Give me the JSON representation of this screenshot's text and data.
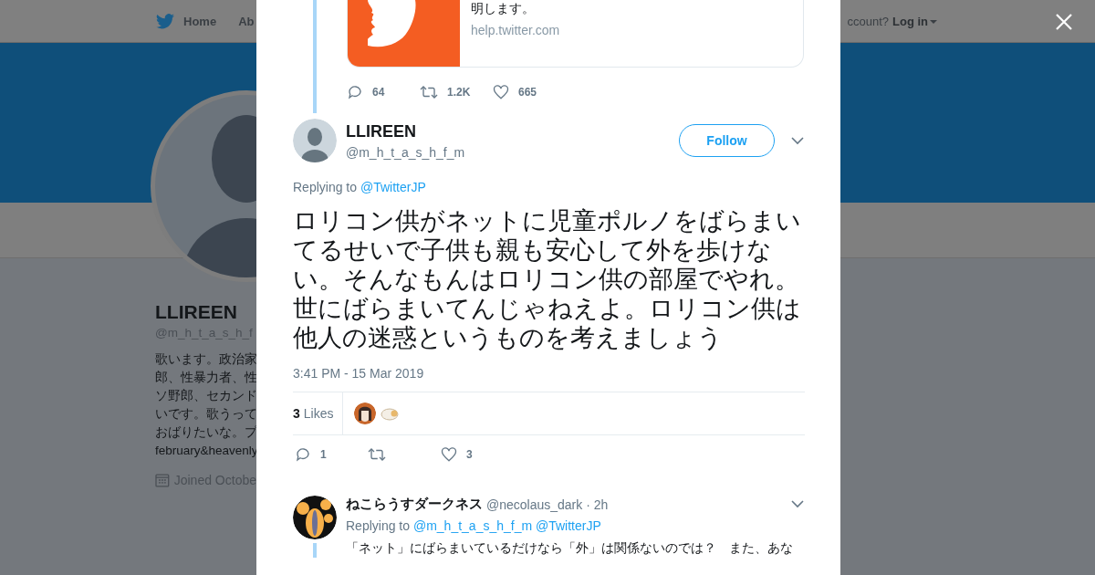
{
  "nav": {
    "home": "Home",
    "about": "Ab",
    "account_prompt": "ccount?",
    "login": "Log in"
  },
  "profile": {
    "name": "LLIREEN",
    "handle": "@m_h_t_a_s_h_f",
    "bio": [
      "歌います。政治家",
      "郎、性暴力者、性",
      "ソ野郎、セカンド",
      "いです。歌うって",
      "おばりたいな。プ",
      "february&heavenly"
    ],
    "joined": "Joined Octobe"
  },
  "previous_tweet": {
    "card_text": "明します。",
    "card_domain": "help.twitter.com",
    "replies": "64",
    "retweets": "1.2K",
    "likes": "665"
  },
  "tweet": {
    "name": "LLIREEN",
    "handle": "@m_h_t_a_s_h_f_m",
    "follow": "Follow",
    "replying_prefix": "Replying to",
    "replying_to": [
      "@TwitterJP"
    ],
    "text": "ロリコン供がネットに児童ポルノをばらまいてるせいで子供も親も安心して外を歩けない。そんなもんはロリコン供の部屋でやれ。世にばらまいてんじゃねえよ。ロリコン供は他人の迷惑というものを考えましょう",
    "time": "3:41 PM - 15 Mar 2019",
    "likes_count": "3",
    "likes_label": "Likes",
    "replies": "1",
    "likes": "3"
  },
  "reply": {
    "name": "ねこらうすダークネス",
    "handle": "@necolaus_dark",
    "time": "· 2h",
    "replying_prefix": "Replying to",
    "replying_to": [
      "@m_h_t_a_s_h_f_m",
      "@TwitterJP"
    ],
    "text": "「ネット」にばらまいているだけなら「外」は関係ないのでは？　また、あな"
  }
}
